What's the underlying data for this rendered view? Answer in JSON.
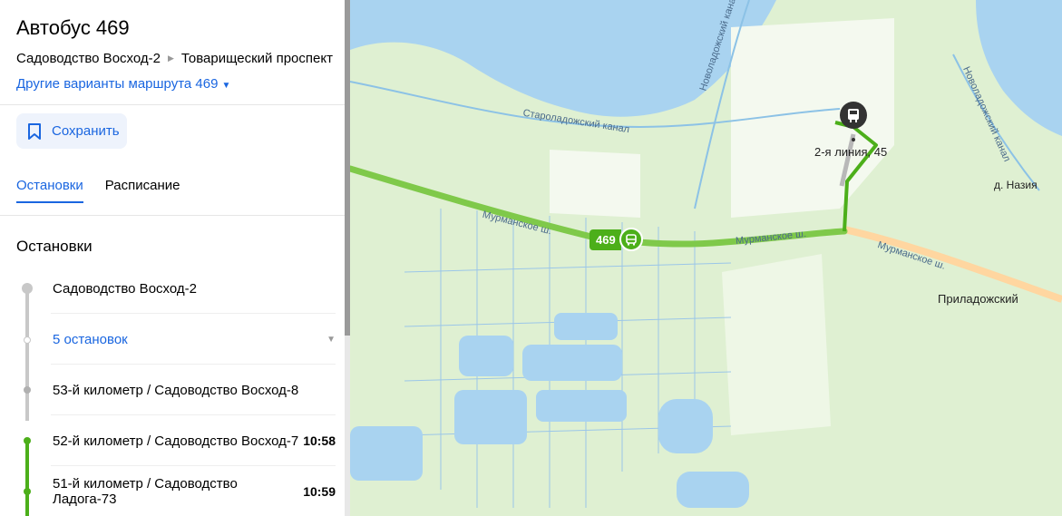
{
  "header": {
    "title": "Автобус 469",
    "from": "Садоводство Восход-2",
    "to": "Товарищеский проспект",
    "variants_link": "Другие варианты маршрута 469"
  },
  "actions": {
    "save_label": "Сохранить"
  },
  "tabs": [
    {
      "label": "Остановки",
      "active": true
    },
    {
      "label": "Расписание",
      "active": false
    }
  ],
  "stops_section": {
    "title": "Остановки",
    "stops": [
      {
        "name": "Садоводство Восход-2",
        "time": ""
      },
      {
        "name": "5 остановок",
        "time": ""
      },
      {
        "name": "53-й километр / Садоводство Восход-8",
        "time": ""
      },
      {
        "name": "52-й километр / Садоводство Восход-7",
        "time": "10:58"
      },
      {
        "name": "51-й километр / Садоводство Ладога-73",
        "time": "10:59"
      }
    ]
  },
  "map": {
    "route_badge": "469",
    "labels": {
      "canal_old": "Староладожский канал",
      "canal_new_left": "Новоладожский канал",
      "canal_new_right": "Новоладожский канал",
      "road_1": "Мурманское ш.",
      "road_2": "Мурманское ш.",
      "road_3": "Мурманское ш.",
      "stop_address": "2-я линия, 45",
      "village_nazia": "д. Назия",
      "village_priladozhsky": "Приладожский"
    }
  },
  "colors": {
    "accent": "#1a66e0",
    "route_green": "#4caf1a",
    "map_land": "#dff0d2",
    "map_water": "#a9d3f0",
    "map_road": "#ffd6a0"
  },
  "icons": {
    "bookmark": "bookmark-icon",
    "bus": "bus-icon",
    "stop_marker": "bus-stop-marker-icon",
    "caret": "chevron-down-icon"
  }
}
